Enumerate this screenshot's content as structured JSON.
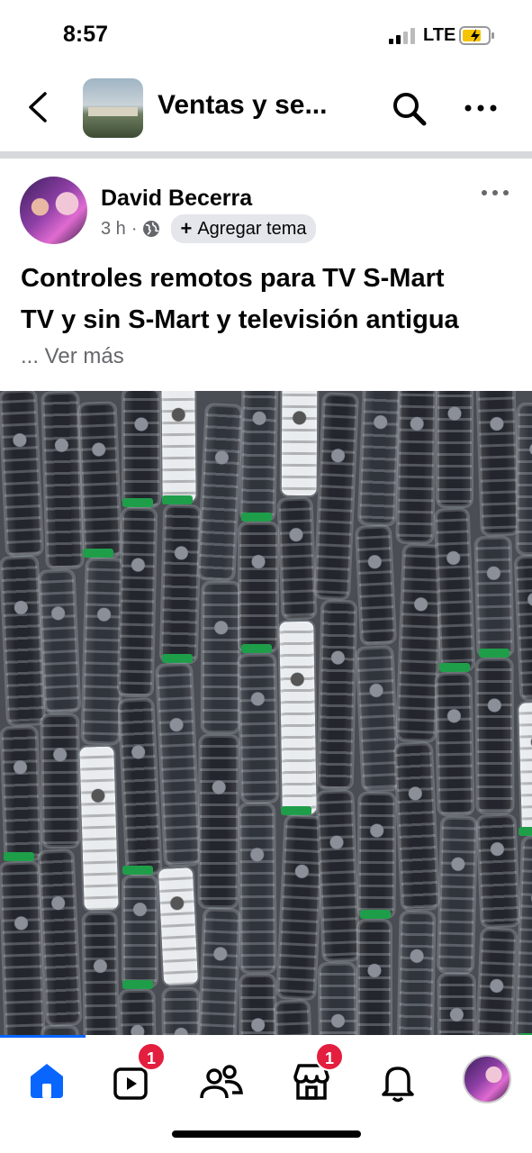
{
  "status_bar": {
    "time": "8:57",
    "network": "LTE"
  },
  "header": {
    "group_title": "Ventas y se...",
    "back_icon": "chevron-left-icon",
    "search_icon": "search-icon",
    "more_icon": "more-horizontal-icon"
  },
  "post": {
    "author": "David Becerra",
    "time": "3 h",
    "separator": "·",
    "add_topic_label": "Agregar tema",
    "text_line1": "Controles remotos para TV S-Mart",
    "text_line2": "TV y sin S-Mart y televisión antigua",
    "see_more": "... Ver más"
  },
  "bottom_nav": {
    "items": [
      {
        "name": "home",
        "badge": ""
      },
      {
        "name": "video",
        "badge": "1"
      },
      {
        "name": "friends",
        "badge": ""
      },
      {
        "name": "marketplace",
        "badge": "1"
      },
      {
        "name": "notifications",
        "badge": ""
      },
      {
        "name": "profile",
        "badge": ""
      }
    ]
  },
  "colors": {
    "accent": "#0866ff",
    "badge": "#e41e3f",
    "secondary_text": "#65676b"
  }
}
